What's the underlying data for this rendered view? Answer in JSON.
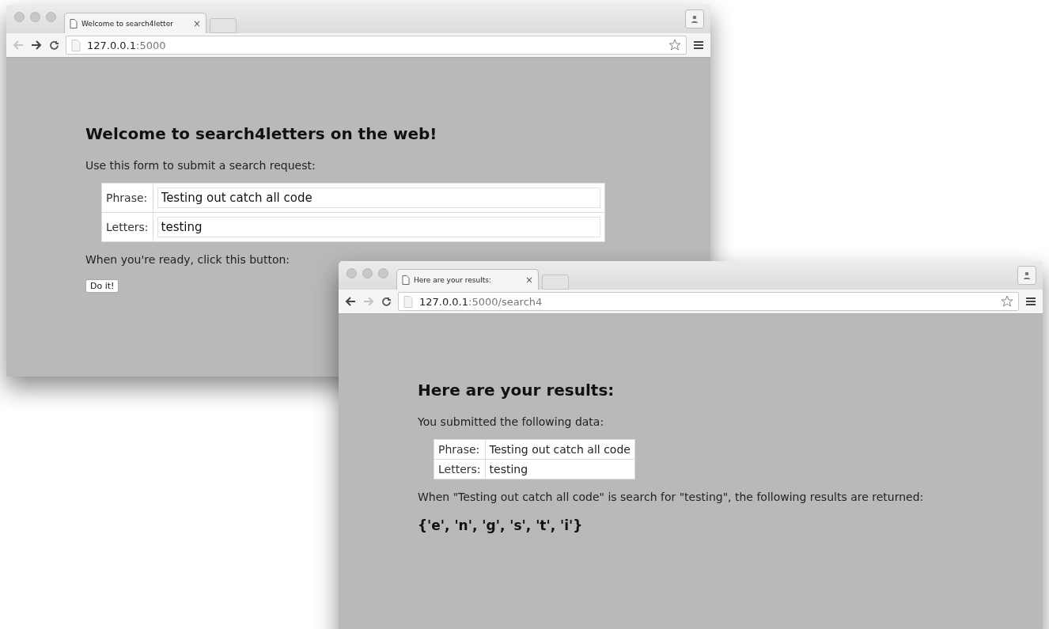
{
  "windows": [
    {
      "kind": "form",
      "tab_title": "Welcome to search4letter",
      "close": "×",
      "url_host": "127.0.0.1",
      "url_path": ":5000",
      "back_enabled": false,
      "forward_enabled": true,
      "heading": "Welcome to search4letters on the web!",
      "intro": "Use this form to submit a search request:",
      "fields": [
        {
          "label": "Phrase:",
          "value": "Testing out catch all code"
        },
        {
          "label": "Letters:",
          "value": "testing"
        }
      ],
      "prompt": "When you're ready, click this button:",
      "button": "Do it!"
    },
    {
      "kind": "results",
      "tab_title": "Here are your results:",
      "close": "×",
      "url_host": "127.0.0.1",
      "url_path": ":5000/search4",
      "back_enabled": true,
      "forward_enabled": false,
      "heading": "Here are your results:",
      "intro": "You submitted the following data:",
      "rows": [
        {
          "label": "Phrase:",
          "value": "Testing out catch all code"
        },
        {
          "label": "Letters:",
          "value": "testing"
        }
      ],
      "message": "When \"Testing out catch all code\" is search for \"testing\", the following results are returned:",
      "result": "{'e', 'n', 'g', 's', 't', 'i'}"
    }
  ]
}
